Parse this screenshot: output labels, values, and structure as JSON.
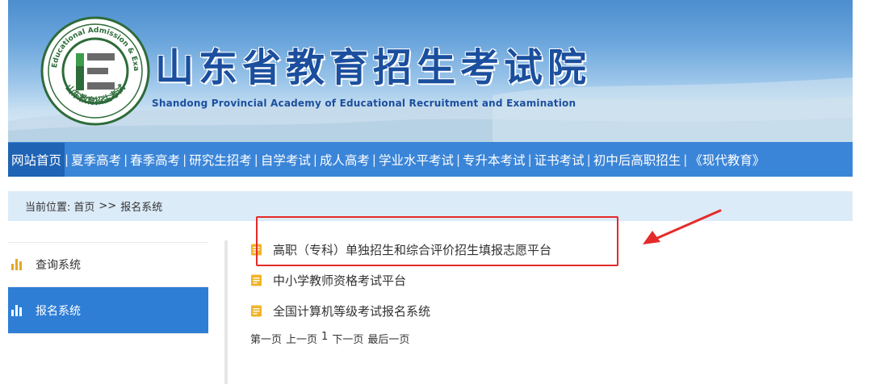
{
  "header": {
    "title": "山东省教育招生考试院",
    "subtitle": "Shandong Provincial Academy of Educational Recruitment and Examination",
    "logo_ring_text": "Shandong Educational Admission & Examinations",
    "logo_bottom_text": "山东教育招生考试"
  },
  "nav": {
    "items": [
      {
        "label": "网站首页",
        "active": true
      },
      {
        "label": "夏季高考"
      },
      {
        "label": "春季高考"
      },
      {
        "label": "研究生招考"
      },
      {
        "label": "自学考试"
      },
      {
        "label": "成人高考"
      },
      {
        "label": "学业水平考试"
      },
      {
        "label": "专升本考试"
      },
      {
        "label": "证书考试"
      },
      {
        "label": "初中后高职招生"
      },
      {
        "label": "《现代教育》"
      }
    ]
  },
  "breadcrumb": {
    "label": "当前位置:",
    "home": "首页",
    "separator": ">>",
    "current": "报名系统"
  },
  "sidebar": {
    "items": [
      {
        "label": "查询系统",
        "selected": false
      },
      {
        "label": "报名系统",
        "selected": true
      }
    ]
  },
  "content": {
    "links": [
      "高职（专科）单独招生和综合评价招生填报志愿平台",
      "中小学教师资格考试平台",
      "全国计算机等级考试报名系统"
    ],
    "pager": {
      "first": "第一页",
      "prev": "上一页",
      "current": "1",
      "next": "下一页",
      "last": "最后一页"
    }
  },
  "colors": {
    "nav_bg": "#3a85d8",
    "nav_active": "#1e63b4",
    "title_blue": "#1b4f9e",
    "breadcrumb_bg": "#dcebf8",
    "sidebar_selected": "#2e7ed6",
    "accent_yellow": "#e2a92a",
    "annotation_red": "#e52a2a"
  }
}
